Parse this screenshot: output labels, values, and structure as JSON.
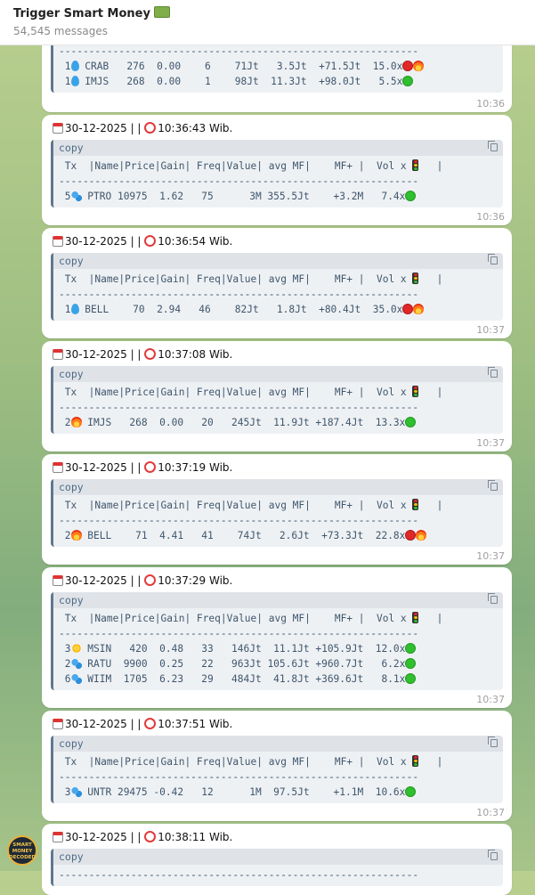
{
  "header": {
    "title": "Trigger Smart Money",
    "subtitle": "54,545 messages"
  },
  "messages": [
    {
      "id": "m0",
      "header_date": "",
      "header_time": "",
      "code_label": "",
      "rows": [
        {
          "tx": "1",
          "icon": "drop",
          "name": "CRAB",
          "price": "276",
          "gain": "0.00",
          "freq": "6",
          "value": "71Jt",
          "avgmf": "3.5Jt",
          "mf": "+71.5Jt",
          "vol": "15.0x",
          "status": [
            "red",
            "fire"
          ]
        },
        {
          "tx": "1",
          "icon": "drop",
          "name": "IMJS",
          "price": "268",
          "gain": "0.00",
          "freq": "1",
          "value": "98Jt",
          "avgmf": "11.3Jt",
          "mf": "+98.0Jt",
          "vol": "5.5x",
          "status": [
            "green"
          ]
        }
      ],
      "time": "10:36"
    },
    {
      "id": "m1",
      "header_date": "30-12-2025",
      "header_sep": " | | ",
      "header_time": "10:36:43 Wib.",
      "code_label": "copy",
      "table_header": " Tx  |Name|Price|Gain| Freq|Value| avg MF|    MF+ |  Vol x",
      "rows": [
        {
          "tx": "5",
          "icon": "drops",
          "name": "PTRO",
          "price": "10975",
          "gain": "1.62",
          "freq": "75",
          "value": "3M",
          "avgmf": "355.5Jt",
          "mf": "+3.2M",
          "vol": "7.4x",
          "status": [
            "green"
          ]
        }
      ],
      "time": "10:36"
    },
    {
      "id": "m2",
      "header_date": "30-12-2025",
      "header_sep": " | | ",
      "header_time": "10:36:54 Wib.",
      "code_label": "copy",
      "table_header": " Tx  |Name|Price|Gain| Freq|Value| avg MF|    MF+ |  Vol x",
      "rows": [
        {
          "tx": "1",
          "icon": "drop",
          "name": "BELL",
          "price": "70",
          "gain": "2.94",
          "freq": "46",
          "value": "82Jt",
          "avgmf": "1.8Jt",
          "mf": "+80.4Jt",
          "vol": "35.0x",
          "status": [
            "red",
            "fire"
          ]
        }
      ],
      "time": "10:37"
    },
    {
      "id": "m3",
      "header_date": "30-12-2025",
      "header_sep": " | | ",
      "header_time": "10:37:08 Wib.",
      "code_label": "copy",
      "table_header": " Tx  |Name|Price|Gain| Freq|Value| avg MF|    MF+ |  Vol x",
      "rows": [
        {
          "tx": "2",
          "icon": "fire",
          "name": "IMJS",
          "price": "268",
          "gain": "0.00",
          "freq": "20",
          "value": "245Jt",
          "avgmf": "11.9Jt",
          "mf": "+187.4Jt",
          "vol": "13.3x",
          "status": [
            "green"
          ]
        }
      ],
      "time": "10:37"
    },
    {
      "id": "m4",
      "header_date": "30-12-2025",
      "header_sep": " | | ",
      "header_time": "10:37:19 Wib.",
      "code_label": "copy",
      "table_header": " Tx  |Name|Price|Gain| Freq|Value| avg MF|    MF+ |  Vol x",
      "rows": [
        {
          "tx": "2",
          "icon": "fire",
          "name": "BELL",
          "price": "71",
          "gain": "4.41",
          "freq": "41",
          "value": "74Jt",
          "avgmf": "2.6Jt",
          "mf": "+73.3Jt",
          "vol": "22.8x",
          "status": [
            "red",
            "fire"
          ]
        }
      ],
      "time": "10:37"
    },
    {
      "id": "m5",
      "header_date": "30-12-2025",
      "header_sep": " | | ",
      "header_time": "10:37:29 Wib.",
      "code_label": "copy",
      "table_header": " Tx  |Name|Price|Gain| Freq|Value| avg MF|    MF+ |  Vol x",
      "rows": [
        {
          "tx": "3",
          "icon": "sun",
          "name": "MSIN",
          "price": "420",
          "gain": "0.48",
          "freq": "33",
          "value": "146Jt",
          "avgmf": "11.1Jt",
          "mf": "+105.9Jt",
          "vol": "12.0x",
          "status": [
            "green"
          ]
        },
        {
          "tx": "2",
          "icon": "drops",
          "name": "RATU",
          "price": "9900",
          "gain": "0.25",
          "freq": "22",
          "value": "963Jt",
          "avgmf": "105.6Jt",
          "mf": "+960.7Jt",
          "vol": "6.2x",
          "status": [
            "green"
          ]
        },
        {
          "tx": "6",
          "icon": "drops",
          "name": "WIIM",
          "price": "1705",
          "gain": "6.23",
          "freq": "29",
          "value": "484Jt",
          "avgmf": "41.8Jt",
          "mf": "+369.6Jt",
          "vol": "8.1x",
          "status": [
            "green"
          ]
        }
      ],
      "time": "10:37"
    },
    {
      "id": "m6",
      "header_date": "30-12-2025",
      "header_sep": " | | ",
      "header_time": "10:37:51 Wib.",
      "code_label": "copy",
      "table_header": " Tx  |Name|Price|Gain| Freq|Value| avg MF|    MF+ |  Vol x",
      "rows": [
        {
          "tx": "3",
          "icon": "drops",
          "name": "UNTR",
          "price": "29475",
          "gain": "-0.42",
          "freq": "12",
          "value": "1M",
          "avgmf": "97.5Jt",
          "mf": "+1.1M",
          "vol": "10.6x",
          "status": [
            "green"
          ]
        }
      ],
      "time": "10:37"
    },
    {
      "id": "m7",
      "header_date": "30-12-2025",
      "header_sep": " | | ",
      "header_time": "10:38:11 Wib.",
      "code_label": "copy",
      "rows": [],
      "time": ""
    }
  ],
  "logo": {
    "line1": "SMART",
    "line2": "MONEY",
    "line3": "DECODED"
  },
  "colors": {
    "accent": "#60788e",
    "code_bg": "#eef1f4",
    "bubble": "#ffffff"
  }
}
